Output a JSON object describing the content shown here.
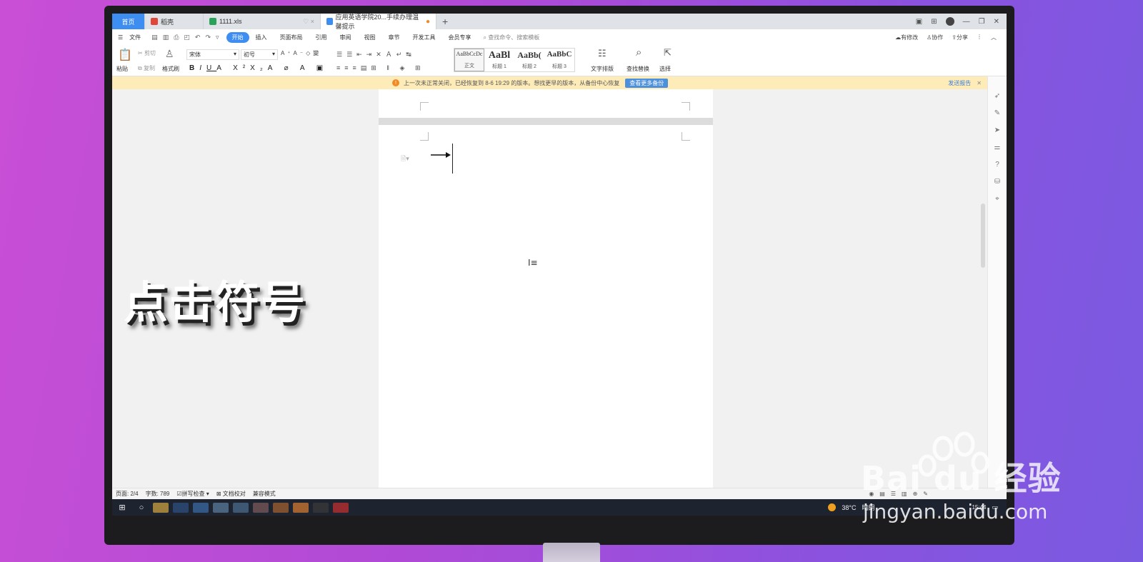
{
  "tabs": {
    "home": "首页",
    "docer": "稻壳",
    "xls": "1111.xls",
    "active": "应用英语学院20...手续办理温馨提示"
  },
  "menu": {
    "file": "文件",
    "items": [
      "开始",
      "插入",
      "页面布局",
      "引用",
      "审阅",
      "视图",
      "章节",
      "开发工具",
      "会员专享"
    ],
    "search_placeholder": "查找命令、搜索模板",
    "has_changes": "有修改",
    "collaborate": "协作",
    "share": "分享"
  },
  "ribbon": {
    "paste": "粘贴",
    "cut": "剪切",
    "copy": "复制",
    "format_painter": "格式刷",
    "font_name": "宋体",
    "font_size": "初号",
    "styles": [
      {
        "preview": "AaBbCcDc",
        "name": "正文"
      },
      {
        "preview": "AaBl",
        "name": "标题 1"
      },
      {
        "preview": "AaBb(",
        "name": "标题 2"
      },
      {
        "preview": "AaBbC",
        "name": "标题 3"
      }
    ],
    "text_layout": "文字排版",
    "find_replace": "查找替换",
    "select": "选择"
  },
  "notification": {
    "message": "上一次未正常关闭，已经恢复到 8-6 19:29 的版本。想找更早的版本，从备份中心恢复",
    "button": "查看更多备份",
    "report": "发送报告"
  },
  "overlay": {
    "title": "点击符号"
  },
  "statusbar": {
    "page": "页面: 2/4",
    "words": "字数: 789",
    "spellcheck": "拼写检查",
    "proofread": "文档校对",
    "compat_mode": "兼容模式"
  },
  "taskbar": {
    "temperature": "38°C",
    "weather": "晴朗",
    "time": "15:44"
  },
  "watermark": {
    "brand": "Bai du 经验",
    "url": "jingyan.baidu.com"
  },
  "colors": {
    "accent": "#3d8ef0",
    "notify_bg": "#fdebb8",
    "warn": "#f08a24"
  }
}
